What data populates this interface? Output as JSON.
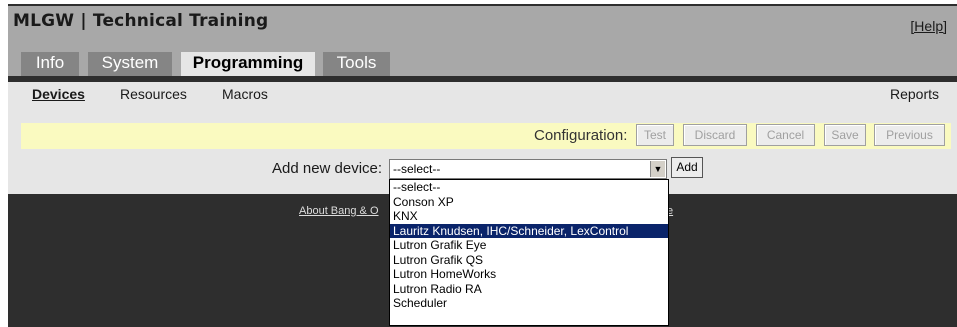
{
  "app": {
    "title": "MLGW | Technical Training",
    "help_label": "[Help]"
  },
  "tabs": [
    {
      "label": "Info"
    },
    {
      "label": "System"
    },
    {
      "label": "Programming",
      "active": true
    },
    {
      "label": "Tools"
    }
  ],
  "subnav": {
    "items": [
      {
        "label": "Devices",
        "active": true
      },
      {
        "label": "Resources"
      },
      {
        "label": "Macros"
      }
    ],
    "reports_label": "Reports"
  },
  "config": {
    "label": "Configuration:",
    "buttons": [
      {
        "label": "Test"
      },
      {
        "label": "Discard"
      },
      {
        "label": "Cancel"
      },
      {
        "label": "Save"
      },
      {
        "label": "Previous"
      }
    ]
  },
  "add_device": {
    "label": "Add new device:",
    "selected": "--select--",
    "add_label": "Add",
    "options": [
      "--select--",
      "Conson XP",
      "KNX",
      "Lauritz Knudsen, IHC/Schneider, LexControl",
      "Lutron Grafik Eye",
      "Lutron Grafik QS",
      "Lutron HomeWorks",
      "Lutron Radio RA",
      "Scheduler"
    ],
    "highlighted_option": "Lauritz Knudsen, IHC/Schneider, LexControl"
  },
  "footer": {
    "link_visible_start": "About Bang & O",
    "link_visible_end": "e"
  },
  "colors": {
    "highlight": "#0a246a",
    "configbar": "#fafac0",
    "tab": "#858585"
  }
}
